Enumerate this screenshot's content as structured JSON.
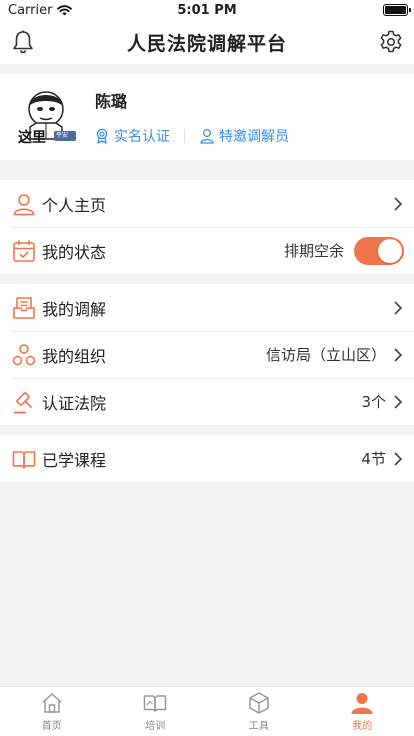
{
  "status": {
    "carrier": "Carrier",
    "time": "5:01 PM"
  },
  "nav": {
    "title": "人民法院调解平台"
  },
  "profile": {
    "name": "陈璐",
    "avatar_text": "这里",
    "avatar_badge": "平安",
    "tag_realname": "实名认证",
    "tag_invited": "特邀调解员"
  },
  "menu": {
    "homepage": {
      "label": "个人主页"
    },
    "status": {
      "label": "我的状态",
      "value": "排期空余"
    },
    "mediation": {
      "label": "我的调解"
    },
    "organization": {
      "label": "我的组织",
      "value": "信访局（立山区）"
    },
    "court": {
      "label": "认证法院",
      "value": "3个"
    },
    "courses": {
      "label": "已学课程",
      "value": "4节"
    }
  },
  "tabs": [
    {
      "label": "首页"
    },
    {
      "label": "培训"
    },
    {
      "label": "工具"
    },
    {
      "label": "我的"
    }
  ],
  "colors": {
    "accent": "#f0754a",
    "link": "#3a8ee6"
  }
}
